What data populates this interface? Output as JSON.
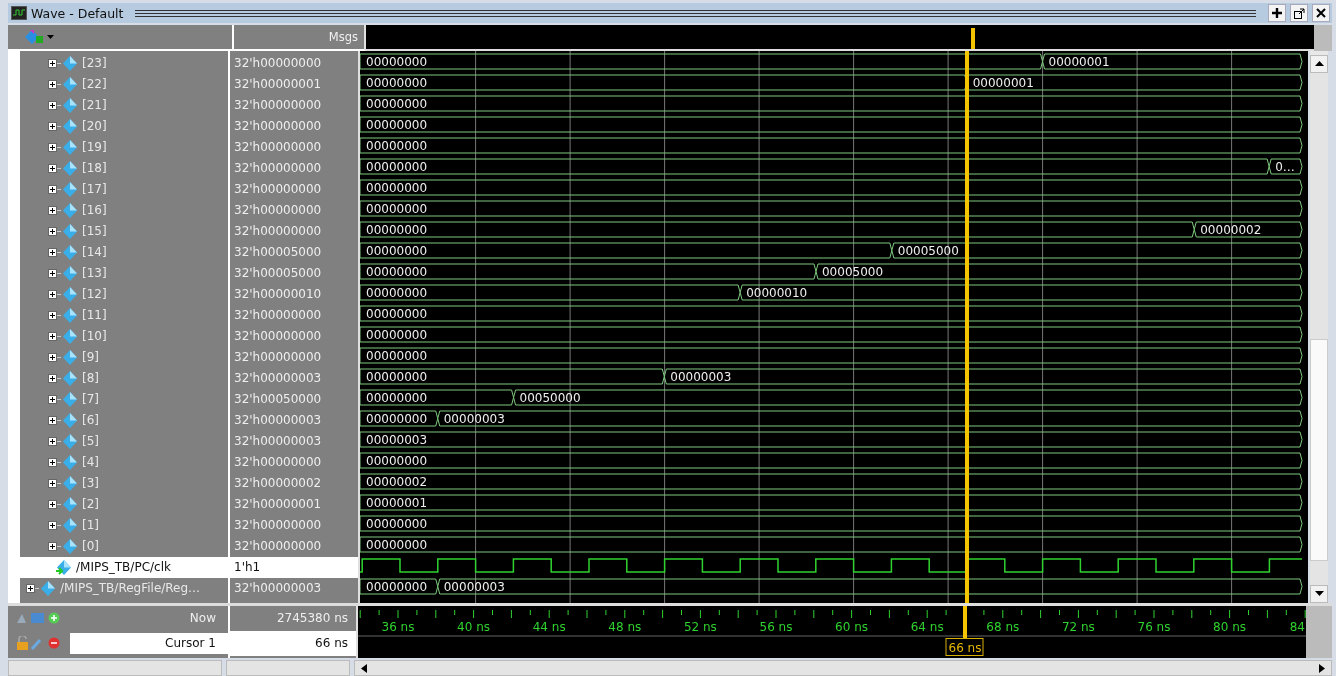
{
  "window": {
    "title": "Wave - Default"
  },
  "header": {
    "values_column": "Msgs"
  },
  "signals": [
    {
      "kind": "element",
      "name": "[23]",
      "value": "32'h00000000",
      "selected": false,
      "wave": {
        "initial": "00000000",
        "changes": [
          {
            "level": 0.72,
            "value": "00000001"
          }
        ]
      }
    },
    {
      "kind": "element",
      "name": "[22]",
      "value": "32'h00000001",
      "selected": false,
      "wave": {
        "initial": "00000000",
        "changes": [
          {
            "level": 0.64,
            "value": "00000001"
          }
        ]
      }
    },
    {
      "kind": "element",
      "name": "[21]",
      "value": "32'h00000000",
      "selected": false,
      "wave": {
        "initial": "00000000"
      }
    },
    {
      "kind": "element",
      "name": "[20]",
      "value": "32'h00000000",
      "selected": false,
      "wave": {
        "initial": "00000000"
      }
    },
    {
      "kind": "element",
      "name": "[19]",
      "value": "32'h00000000",
      "selected": false,
      "wave": {
        "initial": "00000000"
      }
    },
    {
      "kind": "element",
      "name": "[18]",
      "value": "32'h00000000",
      "selected": false,
      "wave": {
        "initial": "00000000",
        "changes": [
          {
            "level": 0.959,
            "value": "0…"
          }
        ]
      }
    },
    {
      "kind": "element",
      "name": "[17]",
      "value": "32'h00000000",
      "selected": false,
      "wave": {
        "initial": "00000000"
      }
    },
    {
      "kind": "element",
      "name": "[16]",
      "value": "32'h00000000",
      "selected": false,
      "wave": {
        "initial": "00000000"
      }
    },
    {
      "kind": "element",
      "name": "[15]",
      "value": "32'h00000000",
      "selected": false,
      "wave": {
        "initial": "00000000",
        "changes": [
          {
            "level": 0.88,
            "value": "00000002"
          }
        ]
      }
    },
    {
      "kind": "element",
      "name": "[14]",
      "value": "32'h00005000",
      "selected": false,
      "wave": {
        "initial": "00000000",
        "changes": [
          {
            "level": 0.561,
            "value": "00005000"
          }
        ]
      }
    },
    {
      "kind": "element",
      "name": "[13]",
      "value": "32'h00005000",
      "selected": false,
      "wave": {
        "initial": "00000000",
        "changes": [
          {
            "level": 0.481,
            "value": "00005000"
          }
        ]
      }
    },
    {
      "kind": "element",
      "name": "[12]",
      "value": "32'h00000010",
      "selected": false,
      "wave": {
        "initial": "00000000",
        "changes": [
          {
            "level": 0.401,
            "value": "00000010"
          }
        ]
      }
    },
    {
      "kind": "element",
      "name": "[11]",
      "value": "32'h00000000",
      "selected": false,
      "wave": {
        "initial": "00000000"
      }
    },
    {
      "kind": "element",
      "name": "[10]",
      "value": "32'h00000000",
      "selected": false,
      "wave": {
        "initial": "00000000"
      }
    },
    {
      "kind": "element",
      "name": "[9]",
      "value": "32'h00000000",
      "selected": false,
      "wave": {
        "initial": "00000000"
      }
    },
    {
      "kind": "element",
      "name": "[8]",
      "value": "32'h00000003",
      "selected": false,
      "wave": {
        "initial": "00000000",
        "changes": [
          {
            "level": 0.321,
            "value": "00000003"
          }
        ]
      }
    },
    {
      "kind": "element",
      "name": "[7]",
      "value": "32'h00050000",
      "selected": false,
      "wave": {
        "initial": "00000000",
        "changes": [
          {
            "level": 0.162,
            "value": "00050000"
          }
        ]
      }
    },
    {
      "kind": "element",
      "name": "[6]",
      "value": "32'h00000003",
      "selected": false,
      "wave": {
        "initial": "00000000",
        "changes": [
          {
            "level": 0.082,
            "value": "00000003"
          }
        ]
      }
    },
    {
      "kind": "element",
      "name": "[5]",
      "value": "32'h00000003",
      "selected": false,
      "wave": {
        "initial": "00000003"
      }
    },
    {
      "kind": "element",
      "name": "[4]",
      "value": "32'h00000000",
      "selected": false,
      "wave": {
        "initial": "00000000"
      }
    },
    {
      "kind": "element",
      "name": "[3]",
      "value": "32'h00000002",
      "selected": false,
      "wave": {
        "initial": "00000002"
      }
    },
    {
      "kind": "element",
      "name": "[2]",
      "value": "32'h00000001",
      "selected": false,
      "wave": {
        "initial": "00000001"
      }
    },
    {
      "kind": "element",
      "name": "[1]",
      "value": "32'h00000000",
      "selected": false,
      "wave": {
        "initial": "00000000"
      }
    },
    {
      "kind": "element",
      "name": "[0]",
      "value": "32'h00000000",
      "selected": false,
      "wave": {
        "initial": "00000000"
      }
    },
    {
      "kind": "clock",
      "name": "/MIPS_TB/PC/clk",
      "value": "1'h1",
      "selected": true
    },
    {
      "kind": "bus",
      "name": "/MIPS_TB/RegFile/Reg…",
      "value": "32'h00000003",
      "selected": false,
      "wave": {
        "initial": "00000000",
        "changes": [
          {
            "level": 0.082,
            "value": "00000003"
          }
        ]
      }
    }
  ],
  "footer": {
    "now_label": "Now",
    "now_value": "2745380 ns",
    "cursor_label": "Cursor 1",
    "cursor_value": "66 ns"
  },
  "timeline": {
    "labels": [
      "36 ns",
      "40 ns",
      "44 ns",
      "48 ns",
      "52 ns",
      "56 ns",
      "60 ns",
      "64 ns",
      "68 ns",
      "72 ns",
      "76 ns",
      "80 ns",
      "84"
    ],
    "cursor_marker": "66 ns"
  }
}
